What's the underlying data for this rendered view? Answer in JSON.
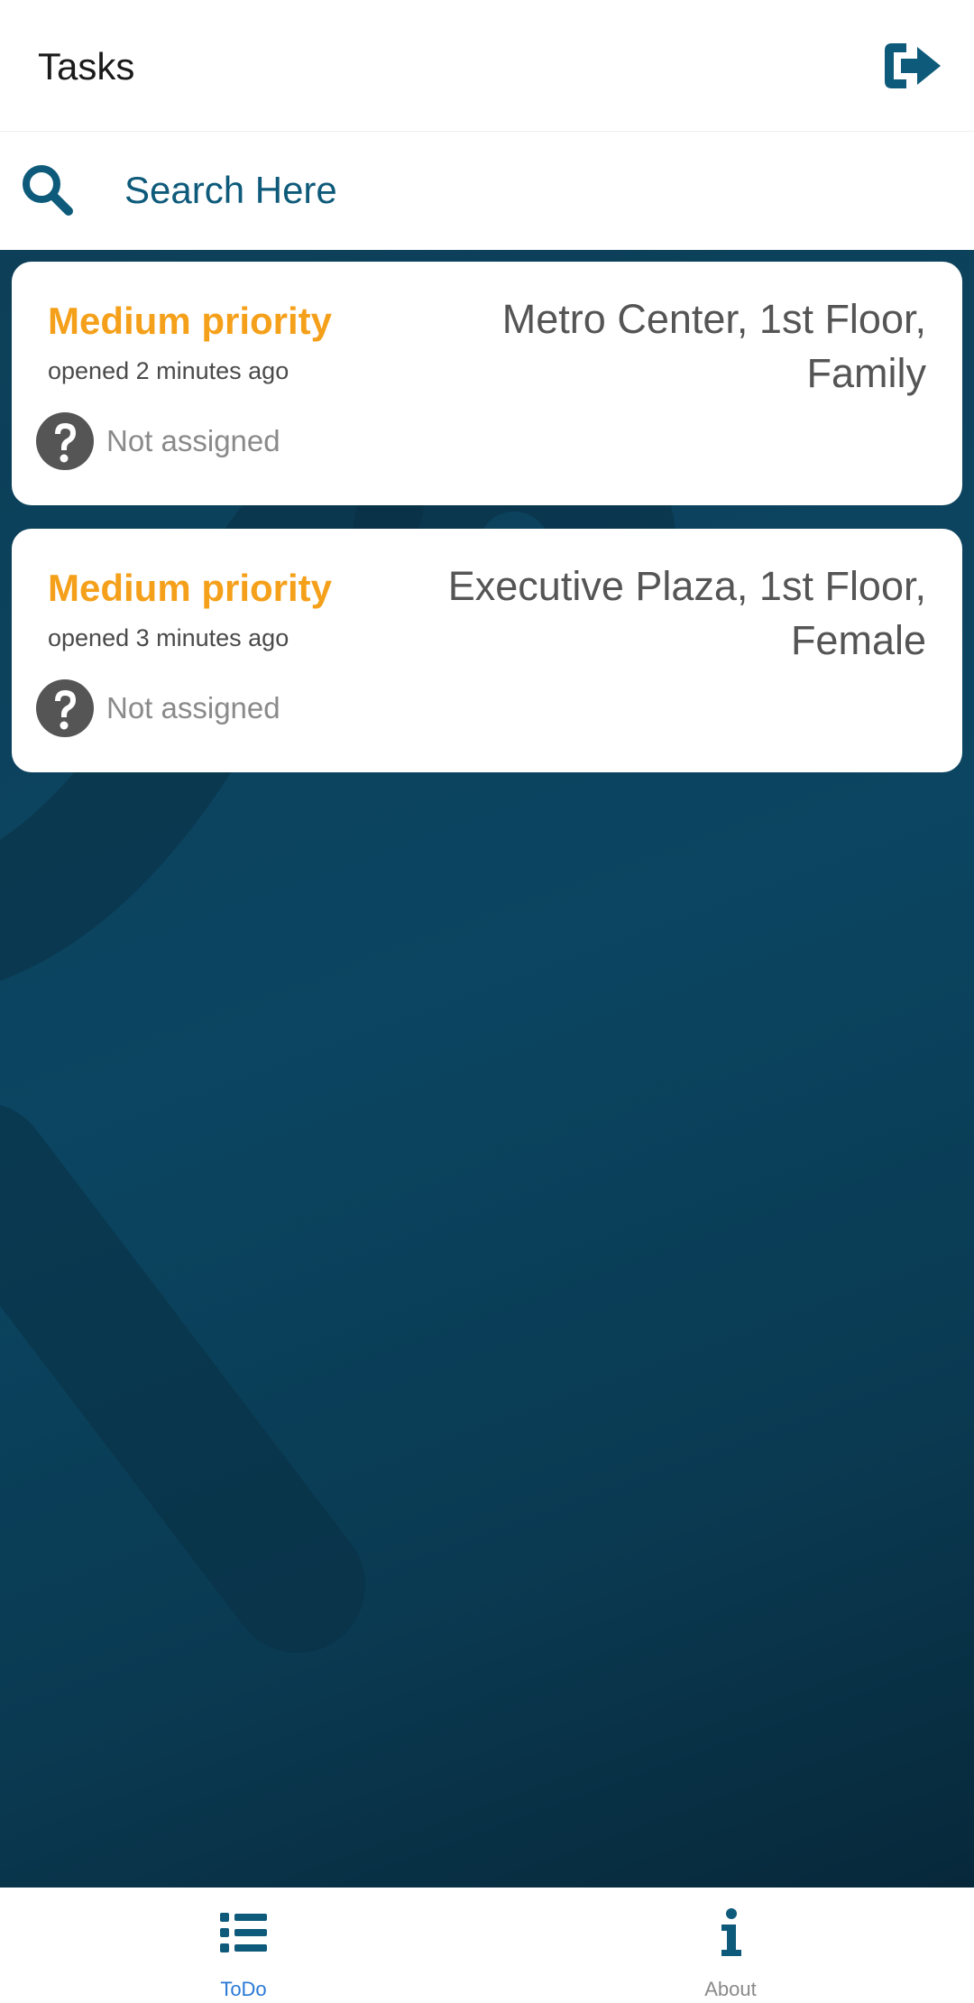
{
  "header": {
    "title": "Tasks",
    "logout_icon": "logout-icon"
  },
  "search": {
    "placeholder": "Search Here",
    "icon": "search-icon"
  },
  "tasks": [
    {
      "priority": "Medium priority",
      "opened": "opened 2 minutes ago",
      "location": "Metro Center, 1st Floor, Family",
      "assignee": "Not assigned",
      "assignee_icon": "question-circle-icon"
    },
    {
      "priority": "Medium priority",
      "opened": "opened 3 minutes ago",
      "location": "Executive Plaza, 1st Floor, Female",
      "assignee": "Not assigned",
      "assignee_icon": "question-circle-icon"
    }
  ],
  "bottom_nav": {
    "items": [
      {
        "label": "ToDo",
        "icon": "list-icon",
        "active": true
      },
      {
        "label": "About",
        "icon": "info-icon",
        "active": false
      }
    ]
  },
  "colors": {
    "brand": "#0e5a7a",
    "priority_medium": "#f5a01a",
    "nav_active": "#2a78d6",
    "background": "#0b3a52"
  }
}
